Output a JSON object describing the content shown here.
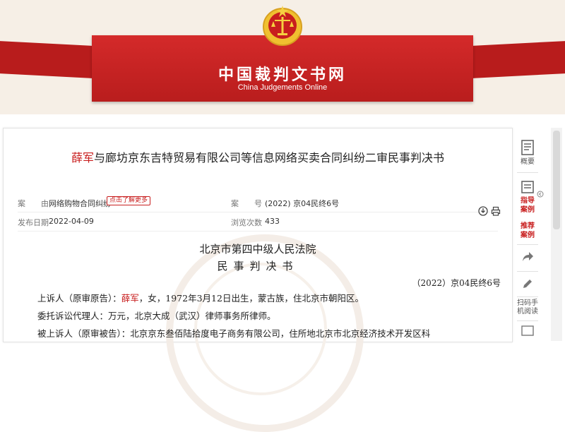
{
  "site": {
    "title": "中国裁判文书网",
    "subtitle": "China Judgements Online"
  },
  "document": {
    "title_party": "薛军",
    "title_rest": "与廊坊京东吉特贸易有限公司等信息网络买卖合同纠纷二审民事判决书",
    "meta": {
      "cause_label": "案　　由",
      "cause_value": "网络购物合同纠纷",
      "cause_tag": "点击了解更多",
      "case_no_label": "案　　号",
      "case_no_value": "(2022) 京04民终6号",
      "publish_label": "发布日期",
      "publish_value": "2022-04-09",
      "views_label": "浏览次数",
      "views_value": "433"
    },
    "court_name": "北京市第四中级人民法院",
    "doc_type": "民事判决书",
    "case_number": "（2022）京04民终6号",
    "paragraphs": [
      {
        "prefix": "上诉人（原审原告）：",
        "name": "薛军",
        "rest": "，女，1972年3月12日出生，蒙古族，住北京市朝阳区。"
      },
      {
        "prefix": "委托诉讼代理人：万元，北京大成（武汉）律师事务所律师。",
        "name": "",
        "rest": ""
      },
      {
        "prefix": "被上诉人（原审被告）：北京京东叁佰陆拾度电子商务有限公司，住所地北京市北京经济技术开发区科",
        "name": "",
        "rest": ""
      }
    ]
  },
  "rail": {
    "summary": "概要",
    "guide": [
      "指导",
      "案例"
    ],
    "recommend": [
      "推荐",
      "案例"
    ],
    "scan": [
      "扫码手",
      "机阅读"
    ]
  },
  "colors": {
    "brand_red": "#c81e1e",
    "banner_bg": "#f6efe6"
  }
}
